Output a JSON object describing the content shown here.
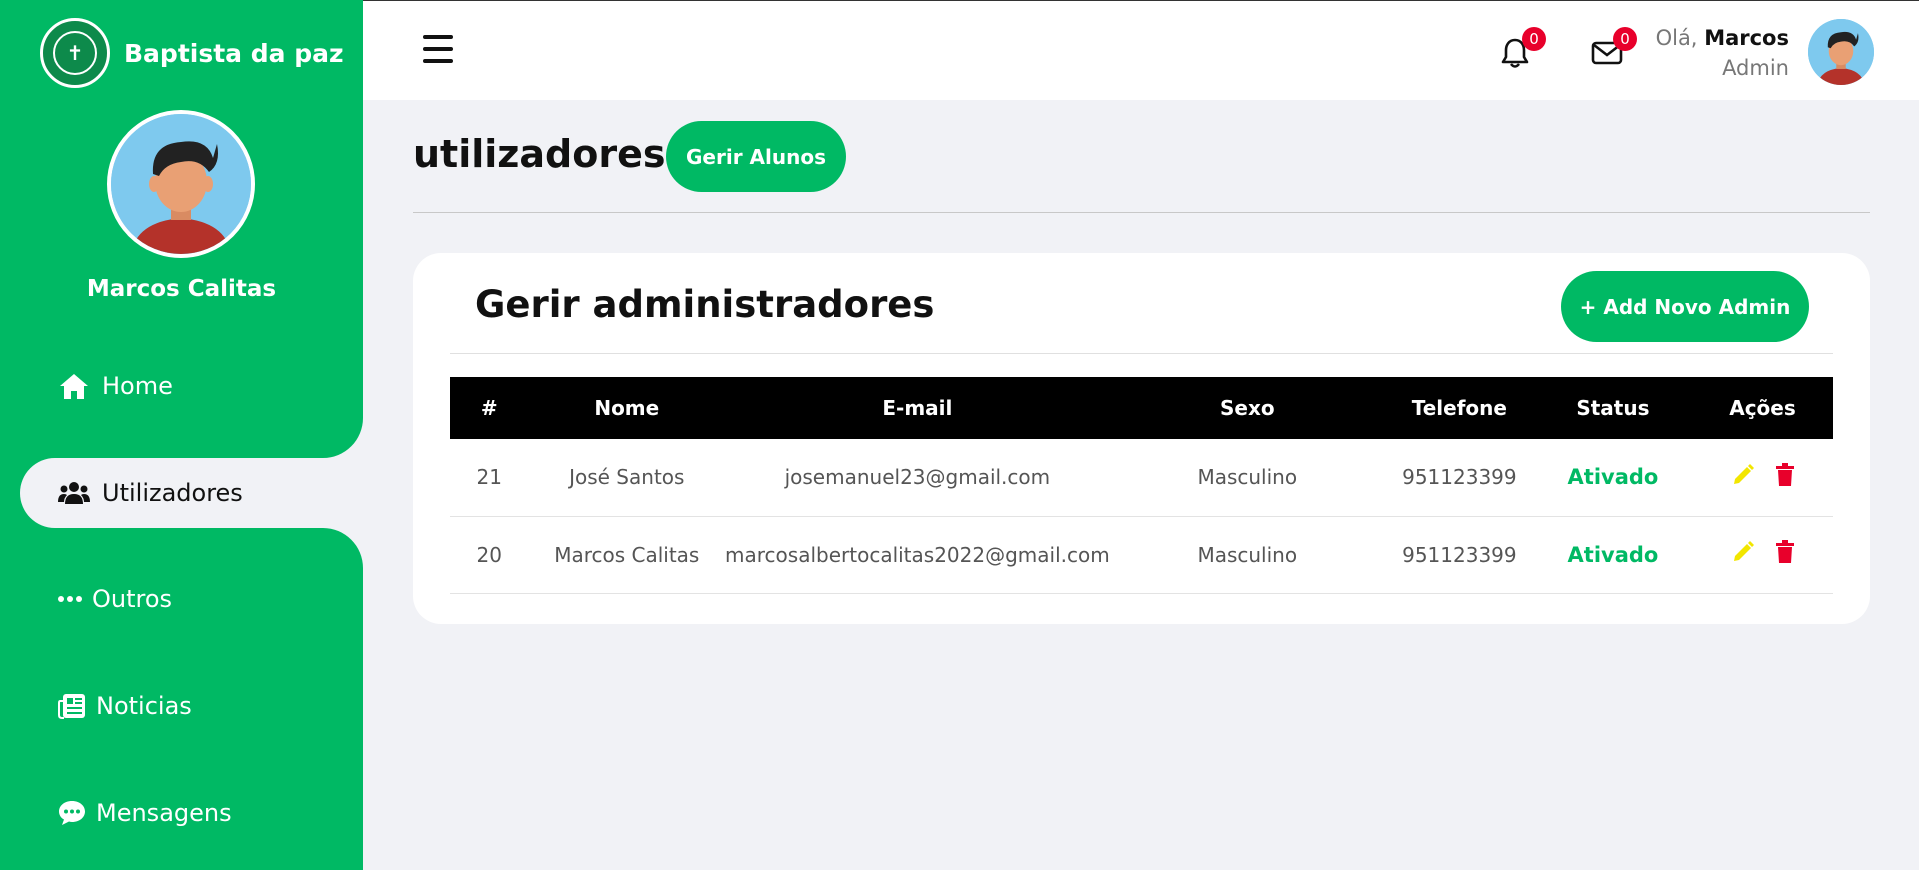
{
  "brand": {
    "name": "Baptista da paz",
    "logo_icon": "school-crest-icon"
  },
  "profile": {
    "name": "Marcos Calitas"
  },
  "sidebar": {
    "items": [
      {
        "label": "Home",
        "icon": "home-icon"
      },
      {
        "label": "Utilizadores",
        "icon": "users-icon",
        "active": true
      },
      {
        "label": "Outros",
        "icon": "more-dots-icon"
      },
      {
        "label": "Noticias",
        "icon": "newspaper-icon"
      },
      {
        "label": "Mensagens",
        "icon": "chat-icon"
      }
    ]
  },
  "topbar": {
    "notifications_count": "0",
    "messages_count": "0",
    "greeting": "Olá,",
    "user_name": "Marcos",
    "user_role": "Admin"
  },
  "main": {
    "title": "utilizadores",
    "gerir_alunos_label": "Gerir Alunos"
  },
  "card": {
    "title": "Gerir administradores",
    "add_button_label": "+ Add Novo Admin"
  },
  "table": {
    "headers": [
      "#",
      "Nome",
      "E-mail",
      "Sexo",
      "Telefone",
      "Status",
      "Ações"
    ],
    "rows": [
      {
        "id": "21",
        "nome": "José Santos",
        "email": "josemanuel23@gmail.com",
        "sexo": "Masculino",
        "telefone": "951123399",
        "status": "Ativado"
      },
      {
        "id": "20",
        "nome": "Marcos Calitas",
        "email": "marcosalbertocalitas2022@gmail.com",
        "sexo": "Masculino",
        "telefone": "951123399",
        "status": "Ativado"
      }
    ]
  },
  "colors": {
    "primary": "#00b964",
    "background": "#f1f2f6",
    "edit": "#f2e600",
    "delete": "#e8002b",
    "table_header": "#000000"
  }
}
